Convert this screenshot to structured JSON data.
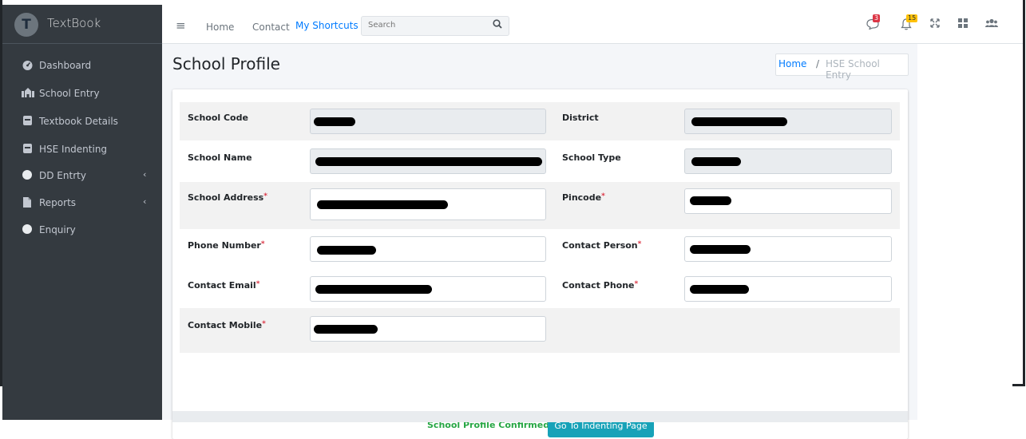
{
  "brand": {
    "logo": "T",
    "name": "TextBook"
  },
  "sidebar": {
    "items": [
      {
        "label": "Dashboard",
        "icon": "dashboard-icon",
        "chevron": ""
      },
      {
        "label": "School Entry",
        "icon": "school-icon",
        "chevron": ""
      },
      {
        "label": "Textbook Details",
        "icon": "book-icon",
        "chevron": ""
      },
      {
        "label": "HSE Indenting",
        "icon": "book-icon",
        "chevron": ""
      },
      {
        "label": "DD Entrty",
        "icon": "circle-icon",
        "chevron": "‹"
      },
      {
        "label": "Reports",
        "icon": "file-icon",
        "chevron": "‹"
      },
      {
        "label": "Enquiry",
        "icon": "circle-icon",
        "chevron": ""
      }
    ]
  },
  "topnav": {
    "menu_icon": "≡",
    "home": "Home",
    "contact": "Contact",
    "shortcuts": "My Shortcuts",
    "search_placeholder": "Search",
    "messages_badge": "3",
    "notifications_badge": "15"
  },
  "page": {
    "title": "School Profile"
  },
  "breadcrumb": {
    "home": "Home",
    "sep": "/",
    "current": "HSE School Entry"
  },
  "form": {
    "school_code_label": "School Code",
    "district_label": "District",
    "school_name_label": "School Name",
    "school_type_label": "School Type",
    "school_address_label": "School Address",
    "pincode_label": "Pincode",
    "phone_number_label": "Phone Number",
    "contact_person_label": "Contact Person",
    "contact_email_label": "Contact Email",
    "contact_phone_label": "Contact Phone",
    "contact_mobile_label": "Contact Mobile",
    "required_mark": "*"
  },
  "status": {
    "confirmed": "School Profile Confirmed!!"
  },
  "actions": {
    "go_indenting": "Go To Indenting Page"
  },
  "colors": {
    "sidebar_bg": "#343a40",
    "accent": "#007bff",
    "success": "#28a745",
    "button": "#17a2b8",
    "badge_red": "#dc3545",
    "badge_yellow": "#ffc107"
  }
}
